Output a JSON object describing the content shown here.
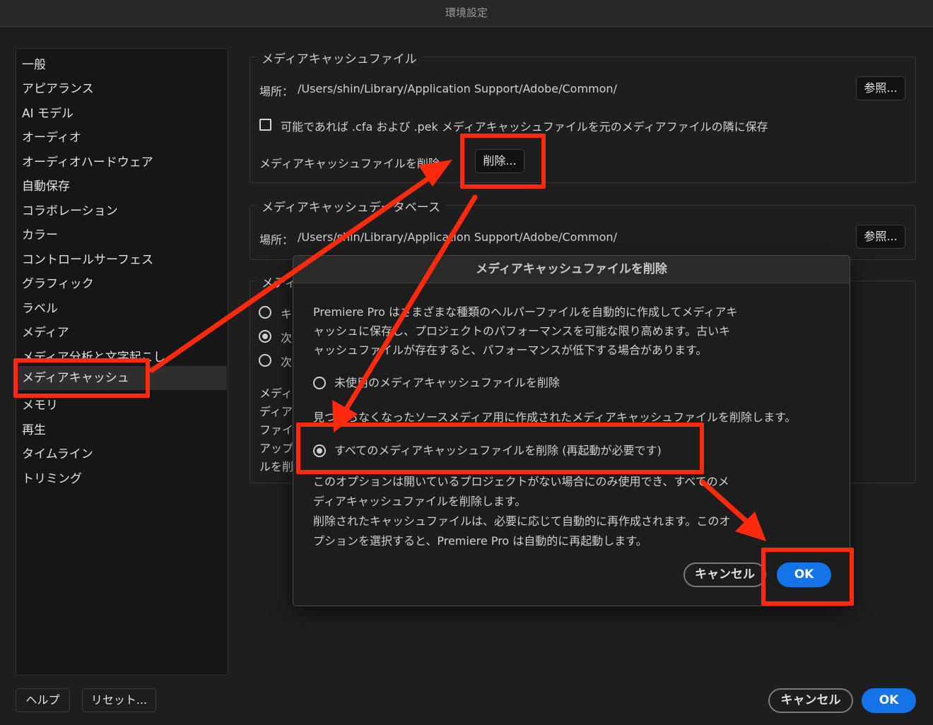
{
  "window": {
    "title": "環境設定"
  },
  "sidebar": {
    "items": [
      "一般",
      "アピアランス",
      "AI モデル",
      "オーディオ",
      "オーディオハードウェア",
      "自動保存",
      "コラボレーション",
      "カラー",
      "コントロールサーフェス",
      "グラフィック",
      "ラベル",
      "メディア",
      "メディア分析と文字起こし",
      "メディアキャッシュ",
      "メモリ",
      "再生",
      "タイムライン",
      "トリミング"
    ],
    "selected": "メディアキャッシュ"
  },
  "cache_files": {
    "title": "メディアキャッシュファイル",
    "location_label": "場所：",
    "location_path": "/Users/shin/Library/Application Support/Adobe/Common/",
    "browse_label": "参照...",
    "save_next_label": "可能であれば .cfa および .pek メディアキャッシュファイルを元のメディアファイルの隣に保存",
    "save_next_checked": false,
    "delete_label": "メディアキャッシュファイルを削除",
    "delete_button": "削除..."
  },
  "cache_db": {
    "title": "メディアキャッシュデータベース",
    "location_label": "場所：",
    "location_path": "/Users/shin/Library/Application Support/Adobe/Common/",
    "browse_label": "参照..."
  },
  "cache_mgmt": {
    "title_partial": "メディ",
    "radio_fragments": [
      "キ",
      "次",
      "次"
    ],
    "radio_selected_index": 1,
    "desc_fragments": [
      "メディ",
      "ディア",
      "ファイ",
      "アップ",
      "ルを削"
    ]
  },
  "dialog": {
    "title": "メディアキャッシュファイルを削除",
    "intro_lines": [
      "Premiere Pro はさまざまな種類のヘルパーファイルを自動的に作成してメディアキ",
      "ャッシュに保存し、プロジェクトのパフォーマンスを可能な限り高めます。古いキ",
      "ャッシュファイルが存在すると、パフォーマンスが低下する場合があります。"
    ],
    "option1_label": "未使用のメディアキャッシュファイルを削除",
    "option1_desc": "見つからなくなったソースメディア用に作成されたメディアキャッシュファイルを削除します。",
    "option2_label": "すべてのメディアキャッシュファイルを削除 (再起動が必要です)",
    "option2_desc_lines": [
      "このオプションは開いているプロジェクトがない場合にのみ使用でき、すべてのメ",
      "ディアキャッシュファイルを削除します。",
      "削除されたキャッシュファイルは、必要に応じて自動的に再作成されます。このオ",
      "プションを選択すると、Premiere Pro は自動的に再起動します。"
    ],
    "selected_option": 2,
    "cancel_label": "キャンセル",
    "ok_label": "OK"
  },
  "footer": {
    "help_label": "ヘルプ",
    "reset_label": "リセット...",
    "cancel_label": "キャンセル",
    "ok_label": "OK"
  },
  "annotation_color": "#ff2a0e"
}
